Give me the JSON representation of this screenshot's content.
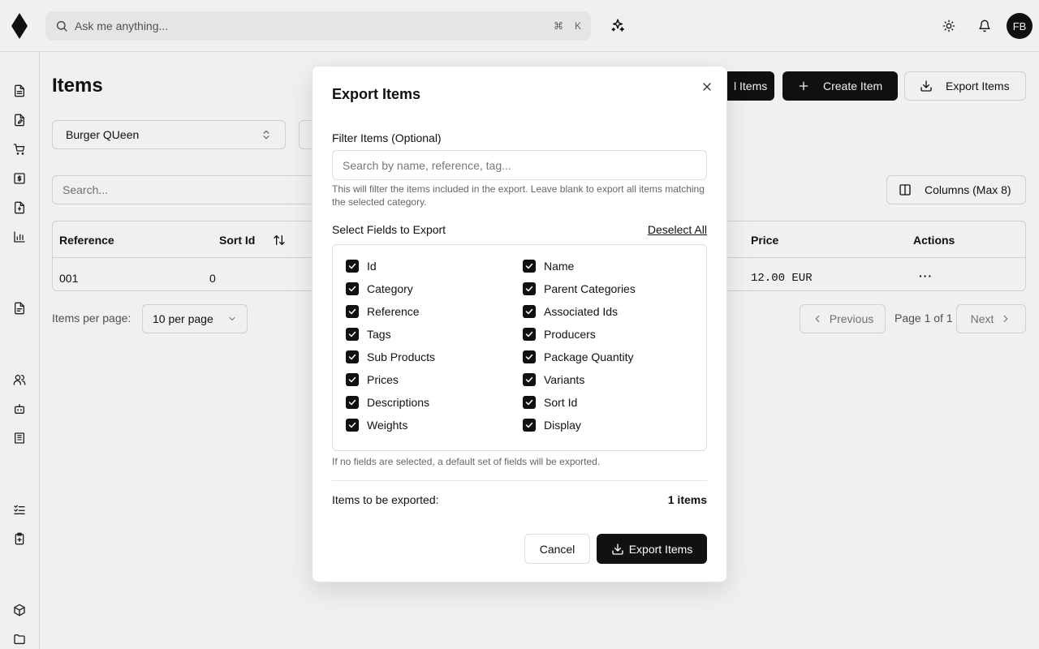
{
  "header": {
    "search_placeholder": "Ask me anything...",
    "shortcut_cmd": "⌘",
    "shortcut_key": "K",
    "avatar_initials": "FB"
  },
  "page": {
    "title": "Items",
    "toolbar": {
      "import_label": "l Items",
      "create_label": "Create Item",
      "export_label": "Export Items",
      "columns_label": "Columns (Max 8)"
    },
    "store_select": "Burger QUeen",
    "search_placeholder": "Search...",
    "table": {
      "headers": [
        "Reference",
        "Sort Id",
        "Price",
        "Actions"
      ],
      "row": {
        "reference": "001",
        "sort_id": "0",
        "price": "12.00 EUR",
        "actions": "···"
      }
    },
    "pagination": {
      "per_page_label": "Items per page:",
      "per_page_value": "10 per page",
      "previous": "Previous",
      "info": "Page 1 of 1",
      "next": "Next"
    }
  },
  "modal": {
    "title": "Export Items",
    "filter_label": "Filter Items (Optional)",
    "filter_placeholder": "Search by name, reference, tag...",
    "filter_help": "This will filter the items included in the export. Leave blank to export all items matching the selected category.",
    "fields_label": "Select Fields to Export",
    "deselect_all": "Deselect All",
    "fields_left": [
      "Id",
      "Category",
      "Reference",
      "Tags",
      "Sub Products",
      "Prices",
      "Descriptions",
      "Weights"
    ],
    "fields_right": [
      "Name",
      "Parent Categories",
      "Associated Ids",
      "Producers",
      "Package Quantity",
      "Variants",
      "Sort Id",
      "Display"
    ],
    "fields_help": "If no fields are selected, a default set of fields will be exported.",
    "count_label": "Items to be exported:",
    "count_value": "1 items",
    "cancel": "Cancel",
    "export": "Export Items"
  }
}
